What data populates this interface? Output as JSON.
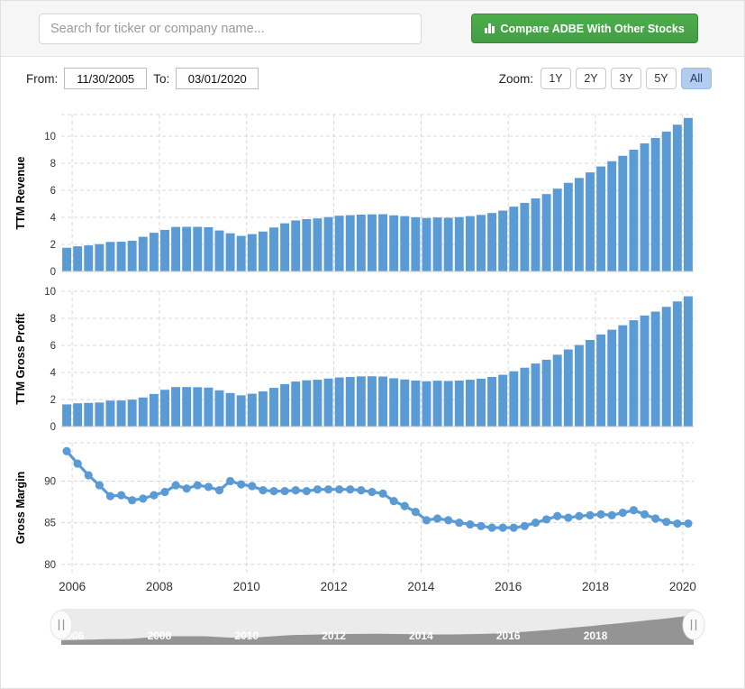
{
  "search": {
    "placeholder": "Search for ticker or company name...",
    "value": ""
  },
  "compare_button": {
    "label": "Compare ADBE With Other Stocks",
    "icon": "bar-chart-icon",
    "color": "#449d44"
  },
  "controls": {
    "from_label": "From:",
    "from_value": "11/30/2005",
    "to_label": "To:",
    "to_value": "03/01/2020",
    "zoom_label": "Zoom:",
    "zoom_options": [
      "1Y",
      "2Y",
      "3Y",
      "5Y",
      "All"
    ],
    "zoom_selected": "All"
  },
  "colors": {
    "series": "#5b9bd5",
    "grid": "#d8d8d8",
    "navigator_area": "#7b7b7b",
    "navigator_bg": "#ebebeb"
  },
  "navigator": {
    "tick_labels": [
      "2006",
      "2008",
      "2010",
      "2012",
      "2014",
      "2016",
      "2018"
    ],
    "left_handle": "range-handle-left",
    "right_handle": "range-handle-right"
  },
  "chart_data": [
    {
      "type": "bar",
      "title": "",
      "ylabel": "TTM Revenue",
      "xlabel": "",
      "ylim": [
        0,
        11.6
      ],
      "yticks": [
        0,
        2,
        4,
        6,
        8,
        10
      ],
      "grid": true,
      "x": [
        "2005-11",
        "2006-02",
        "2006-05",
        "2006-08",
        "2006-11",
        "2007-02",
        "2007-05",
        "2007-08",
        "2007-11",
        "2008-02",
        "2008-05",
        "2008-08",
        "2008-11",
        "2009-02",
        "2009-05",
        "2009-08",
        "2009-11",
        "2010-02",
        "2010-05",
        "2010-08",
        "2010-11",
        "2011-02",
        "2011-05",
        "2011-08",
        "2011-11",
        "2012-02",
        "2012-05",
        "2012-08",
        "2012-11",
        "2013-02",
        "2013-05",
        "2013-08",
        "2013-11",
        "2014-02",
        "2014-05",
        "2014-08",
        "2014-11",
        "2015-02",
        "2015-05",
        "2015-08",
        "2015-11",
        "2016-02",
        "2016-05",
        "2016-08",
        "2016-11",
        "2017-02",
        "2017-05",
        "2017-08",
        "2017-11",
        "2018-02",
        "2018-05",
        "2018-08",
        "2018-11",
        "2019-02",
        "2019-05",
        "2019-08",
        "2019-11",
        "2020-02"
      ],
      "values": [
        1.75,
        1.86,
        1.93,
        2.02,
        2.18,
        2.2,
        2.27,
        2.56,
        2.86,
        3.07,
        3.29,
        3.3,
        3.3,
        3.27,
        3.03,
        2.82,
        2.63,
        2.76,
        2.95,
        3.25,
        3.56,
        3.77,
        3.87,
        3.92,
        4.02,
        4.12,
        4.16,
        4.2,
        4.22,
        4.23,
        4.15,
        4.09,
        4.01,
        3.95,
        3.99,
        3.97,
        4.02,
        4.09,
        4.18,
        4.32,
        4.5,
        4.79,
        5.07,
        5.4,
        5.72,
        6.12,
        6.55,
        6.91,
        7.32,
        7.76,
        8.15,
        8.55,
        9.0,
        9.47,
        9.87,
        10.34,
        10.85,
        11.35
      ]
    },
    {
      "type": "bar",
      "title": "",
      "ylabel": "TTM Gross Profit",
      "xlabel": "",
      "ylim": [
        0,
        10.0
      ],
      "yticks": [
        0,
        2,
        4,
        6,
        8,
        10
      ],
      "grid": true,
      "x": [
        "2005-11",
        "2006-02",
        "2006-05",
        "2006-08",
        "2006-11",
        "2007-02",
        "2007-05",
        "2007-08",
        "2007-11",
        "2008-02",
        "2008-05",
        "2008-08",
        "2008-11",
        "2009-02",
        "2009-05",
        "2009-08",
        "2009-11",
        "2010-02",
        "2010-05",
        "2010-08",
        "2010-11",
        "2011-02",
        "2011-05",
        "2011-08",
        "2011-11",
        "2012-02",
        "2012-05",
        "2012-08",
        "2012-11",
        "2013-02",
        "2013-05",
        "2013-08",
        "2013-11",
        "2014-02",
        "2014-05",
        "2014-08",
        "2014-11",
        "2015-02",
        "2015-05",
        "2015-08",
        "2015-11",
        "2016-02",
        "2016-05",
        "2016-08",
        "2016-11",
        "2017-02",
        "2017-05",
        "2017-08",
        "2017-11",
        "2018-02",
        "2018-05",
        "2018-08",
        "2018-11",
        "2019-02",
        "2019-05",
        "2019-08",
        "2019-11",
        "2020-02"
      ],
      "values": [
        1.64,
        1.72,
        1.75,
        1.78,
        1.92,
        1.93,
        1.99,
        2.15,
        2.41,
        2.72,
        2.92,
        2.92,
        2.91,
        2.88,
        2.68,
        2.48,
        2.31,
        2.43,
        2.6,
        2.86,
        3.14,
        3.33,
        3.42,
        3.46,
        3.55,
        3.63,
        3.67,
        3.71,
        3.72,
        3.7,
        3.57,
        3.48,
        3.4,
        3.35,
        3.39,
        3.37,
        3.4,
        3.46,
        3.54,
        3.67,
        3.83,
        4.09,
        4.35,
        4.66,
        4.94,
        5.31,
        5.7,
        6.03,
        6.4,
        6.81,
        7.16,
        7.49,
        7.86,
        8.21,
        8.5,
        8.85,
        9.25,
        9.63
      ]
    },
    {
      "type": "line",
      "title": "",
      "ylabel": "Gross Margin",
      "xlabel": "",
      "ylim": [
        79.0,
        94.6
      ],
      "yticks": [
        80,
        85,
        90
      ],
      "grid": true,
      "xticks": [
        "2006",
        "2008",
        "2010",
        "2012",
        "2014",
        "2016",
        "2018",
        "2020"
      ],
      "x": [
        "2005-11",
        "2006-02",
        "2006-05",
        "2006-08",
        "2006-11",
        "2007-02",
        "2007-05",
        "2007-08",
        "2007-11",
        "2008-02",
        "2008-05",
        "2008-08",
        "2008-11",
        "2009-02",
        "2009-05",
        "2009-08",
        "2009-11",
        "2010-02",
        "2010-05",
        "2010-08",
        "2010-11",
        "2011-02",
        "2011-05",
        "2011-08",
        "2011-11",
        "2012-02",
        "2012-05",
        "2012-08",
        "2012-11",
        "2013-02",
        "2013-05",
        "2013-08",
        "2013-11",
        "2014-02",
        "2014-05",
        "2014-08",
        "2014-11",
        "2015-02",
        "2015-05",
        "2015-08",
        "2015-11",
        "2016-02",
        "2016-05",
        "2016-08",
        "2016-11",
        "2017-02",
        "2017-05",
        "2017-08",
        "2017-11",
        "2018-02",
        "2018-05",
        "2018-08",
        "2018-11",
        "2019-02",
        "2019-05",
        "2019-08",
        "2019-11",
        "2020-02"
      ],
      "values": [
        93.6,
        92.1,
        90.7,
        89.5,
        88.2,
        88.3,
        87.7,
        87.9,
        88.3,
        88.7,
        89.5,
        89.1,
        89.5,
        89.3,
        88.9,
        90.0,
        89.6,
        89.4,
        88.9,
        88.8,
        88.8,
        88.9,
        88.8,
        89.0,
        89.0,
        89.0,
        89.0,
        88.9,
        88.7,
        88.5,
        87.6,
        87.0,
        86.3,
        85.3,
        85.5,
        85.3,
        85.0,
        84.8,
        84.6,
        84.4,
        84.4,
        84.4,
        84.6,
        85.0,
        85.4,
        85.8,
        85.6,
        85.8,
        85.9,
        86.0,
        85.9,
        86.2,
        86.5,
        86.0,
        85.5,
        85.1,
        84.9,
        84.9
      ]
    }
  ]
}
